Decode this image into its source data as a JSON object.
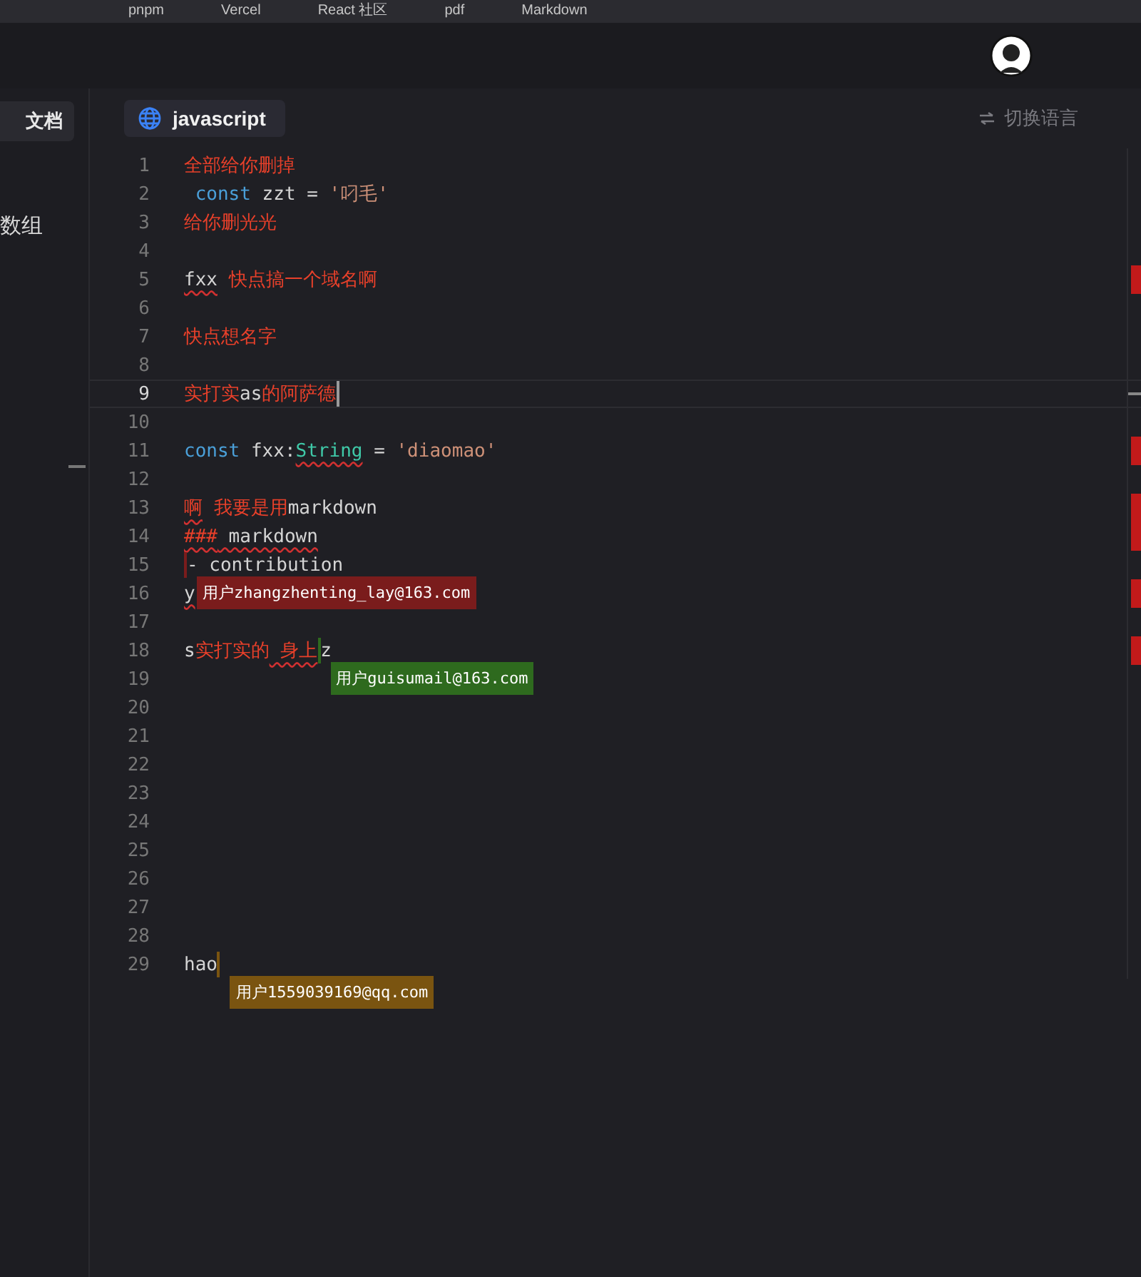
{
  "bookmarks": [
    "pnpm",
    "Vercel",
    "React 社区",
    "pdf",
    "Markdown"
  ],
  "sidebar": {
    "tab": "文档",
    "items": [
      {
        "label": "数组"
      }
    ]
  },
  "editor_tab": {
    "label": "javascript",
    "selected": true
  },
  "switch_language": "切换语言",
  "lines": [
    {
      "number": "1",
      "current": false,
      "segments": [
        {
          "kind": "cn",
          "text": "全部给你删掉",
          "squiggle": false
        }
      ]
    },
    {
      "number": "2",
      "current": false,
      "segments": [
        {
          "kind": "kw",
          "text": " const",
          "squiggle": false
        },
        {
          "kind": "text",
          "text": " zzt = ",
          "squiggle": false
        },
        {
          "kind": "str",
          "text": "'叼毛'",
          "squiggle": false
        }
      ]
    },
    {
      "number": "3",
      "current": false,
      "segments": [
        {
          "kind": "cn",
          "text": "给你删光光",
          "squiggle": false
        }
      ]
    },
    {
      "number": "4",
      "current": false
    },
    {
      "number": "5",
      "current": false,
      "segments": [
        {
          "kind": "text",
          "text": "fxx",
          "squiggle": true
        },
        {
          "kind": "cn",
          "text": " 快点搞一个域名啊",
          "squiggle": false
        }
      ]
    },
    {
      "number": "6",
      "current": false
    },
    {
      "number": "7",
      "current": false,
      "segments": [
        {
          "kind": "cn",
          "text": "快点想名字",
          "squiggle": false
        }
      ]
    },
    {
      "number": "8",
      "current": false
    },
    {
      "number": "9",
      "current": true,
      "segments": [
        {
          "kind": "cn",
          "text": "实打实",
          "squiggle": false
        },
        {
          "kind": "text",
          "text": "as",
          "squiggle": false
        },
        {
          "kind": "cn",
          "text": "的阿萨德",
          "squiggle": false,
          "cursor": {
            "kind": "after",
            "color": "#9a9a9a"
          }
        }
      ]
    },
    {
      "number": "10",
      "current": false
    },
    {
      "number": "11",
      "current": false,
      "segments": [
        {
          "kind": "kw",
          "text": "const",
          "squiggle": false
        },
        {
          "kind": "text",
          "text": " fxx:",
          "squiggle": false
        },
        {
          "kind": "type",
          "text": "String",
          "squiggle": true
        },
        {
          "kind": "text",
          "text": " = ",
          "squiggle": false
        },
        {
          "kind": "str",
          "text": "'diaomao'",
          "squiggle": false
        }
      ]
    },
    {
      "number": "12",
      "current": false
    },
    {
      "number": "13",
      "current": false,
      "segments": [
        {
          "kind": "cn",
          "text": "啊",
          "squiggle": true
        },
        {
          "kind": "cn",
          "text": " 我要是用",
          "squiggle": false
        },
        {
          "kind": "text",
          "text": "markdown",
          "squiggle": false
        }
      ]
    },
    {
      "number": "14",
      "current": false,
      "segments": [
        {
          "kind": "cn",
          "text": "###",
          "squiggle": true
        },
        {
          "kind": "text",
          "text": " markdown",
          "squiggle": true
        }
      ]
    },
    {
      "number": "15",
      "current": false,
      "segments": [
        {
          "kind": "text",
          "text": "- contribution",
          "squiggle": false,
          "cursor": {
            "kind": "before",
            "color": "#7a1c1c",
            "label": "用户zhangzhenting_lay@163.com"
          }
        }
      ]
    },
    {
      "number": "16",
      "current": false,
      "segments": [
        {
          "kind": "text",
          "text": "y",
          "squiggle": true
        }
      ]
    },
    {
      "number": "17",
      "current": false
    },
    {
      "number": "18",
      "current": false,
      "segments": [
        {
          "kind": "text",
          "text": "s",
          "squiggle": false
        },
        {
          "kind": "cn",
          "text": "实打实的",
          "squiggle": false
        },
        {
          "kind": "cn",
          "text": " 身上",
          "squiggle": true,
          "cursor": {
            "kind": "after",
            "color": "#2e6a1e",
            "label": "用户guisumail@163.com"
          }
        },
        {
          "kind": "text",
          "text": "z",
          "squiggle": false
        }
      ]
    },
    {
      "number": "19",
      "current": false
    },
    {
      "number": "20",
      "current": false
    },
    {
      "number": "21",
      "current": false
    },
    {
      "number": "22",
      "current": false
    },
    {
      "number": "23",
      "current": false
    },
    {
      "number": "24",
      "current": false
    },
    {
      "number": "25",
      "current": false
    },
    {
      "number": "26",
      "current": false
    },
    {
      "number": "27",
      "current": false
    },
    {
      "number": "28",
      "current": false
    },
    {
      "number": "29",
      "current": false,
      "segments": [
        {
          "kind": "text",
          "text": "hao",
          "squiggle": false,
          "cursor": {
            "kind": "after",
            "color": "#7a5410",
            "label": "用户1559039169@qq.com"
          }
        }
      ]
    }
  ]
}
